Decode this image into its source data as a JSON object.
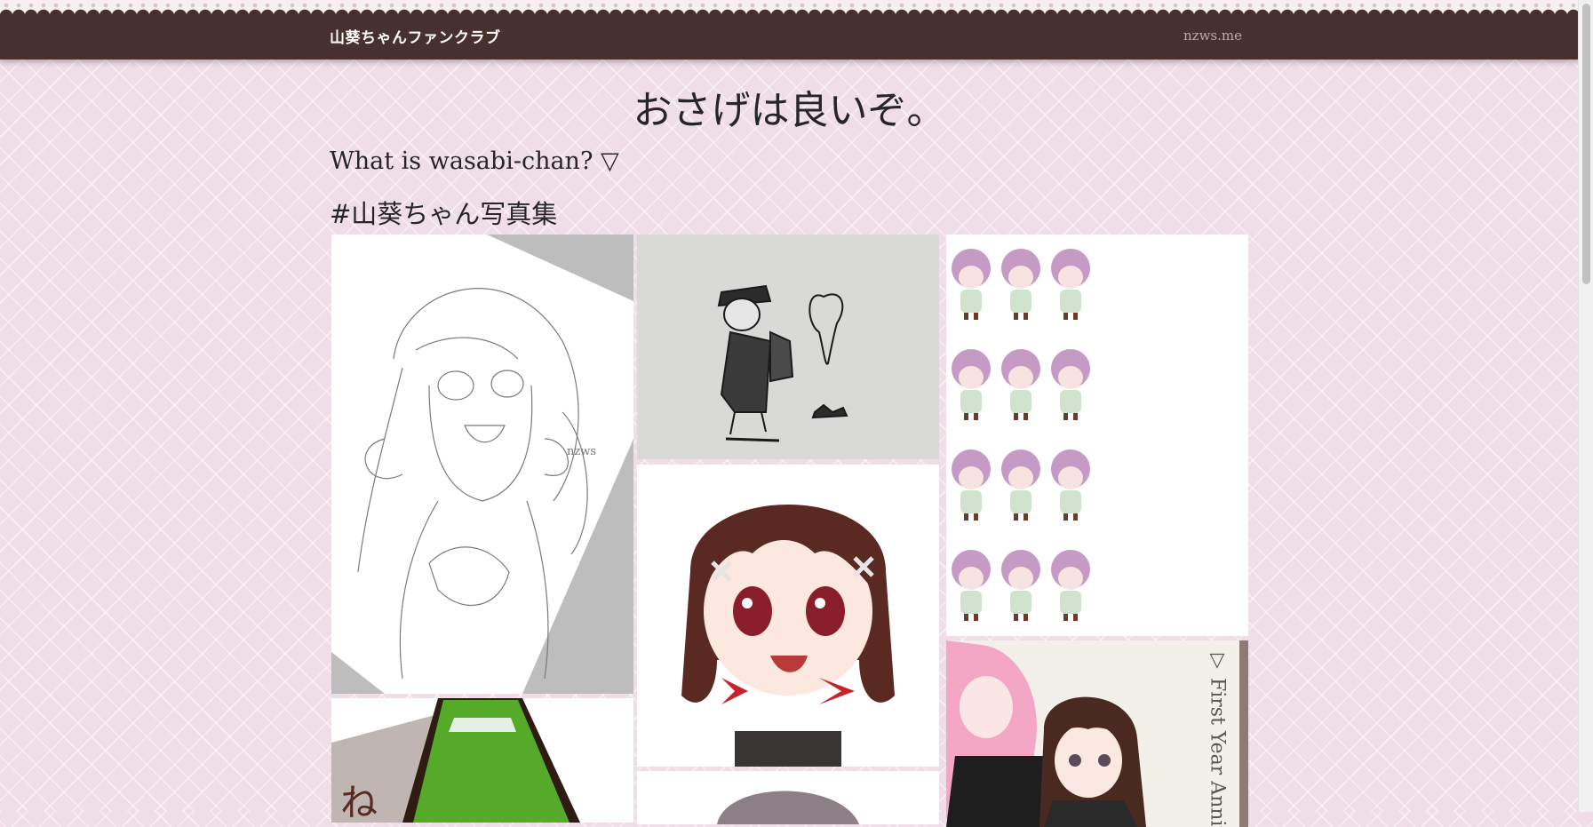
{
  "header": {
    "brand": "山葵ちゃんファンクラブ",
    "site_link": "nzws.me"
  },
  "main": {
    "title": "おさげは良いぞ。",
    "what_is_toggle": "What is wasabi-chan? ▽",
    "gallery_heading": "#山葵ちゃん写真集"
  },
  "gallery": {
    "sprite_sheet_rows": 4,
    "sprite_sheet_cols": 3,
    "artwork_vertical_caption": "▽ First Year Anniv",
    "sketch_signature": "nzws"
  },
  "colors": {
    "header_bg": "#47302d",
    "page_bg": "#efdde7",
    "accent_hair": "#5a2a22",
    "ribbon": "#c8232c"
  }
}
